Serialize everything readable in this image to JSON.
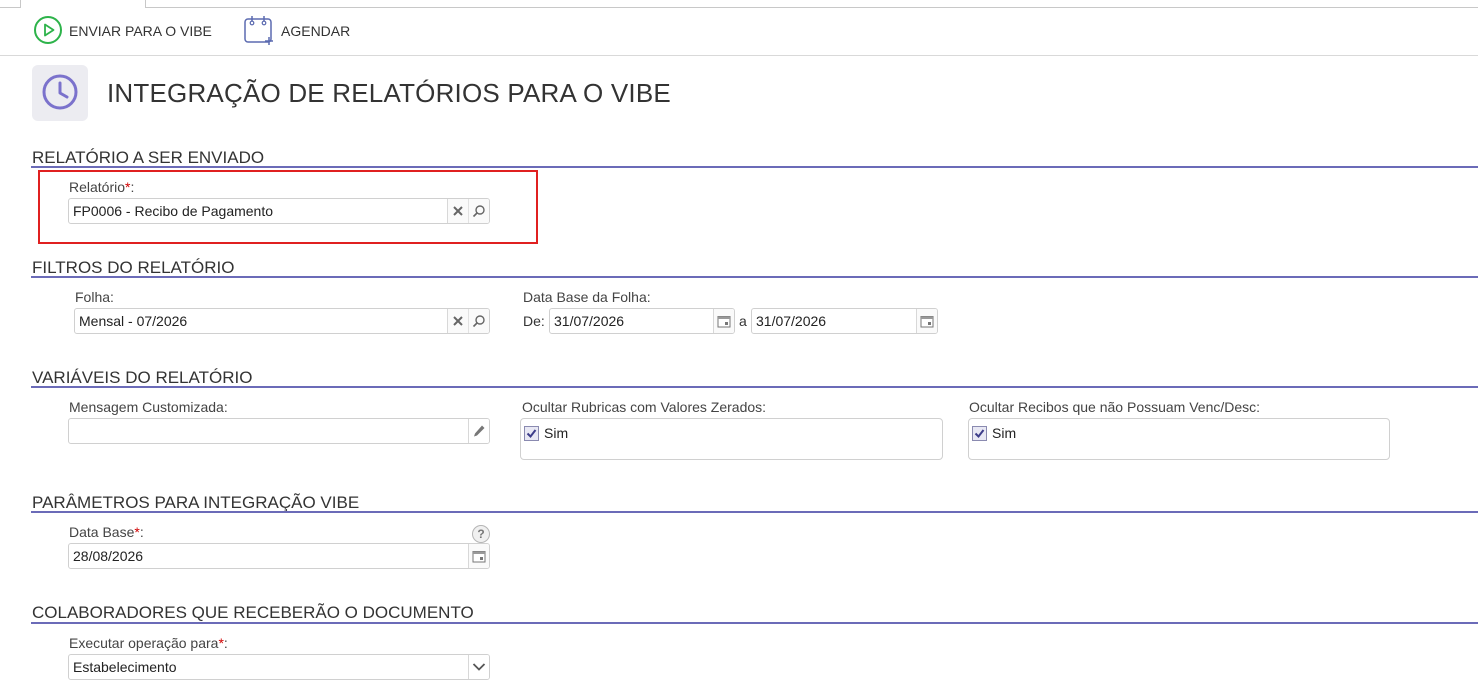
{
  "toolbar": {
    "send_label": "ENVIAR PARA O VIBE",
    "schedule_label": "AGENDAR"
  },
  "page": {
    "title": "INTEGRAÇÃO DE RELATÓRIOS PARA O VIBE"
  },
  "sections": {
    "report": {
      "title": "RELATÓRIO A SER ENVIADO",
      "report_label": "Relatório",
      "report_required": "*",
      "report_label_suffix": ":",
      "report_value": "FP0006 - Recibo de Pagamento"
    },
    "filters": {
      "title": "FILTROS DO RELATÓRIO",
      "folha_label": "Folha:",
      "folha_value": "Mensal - 07/2026",
      "data_base_label": "Data Base da Folha:",
      "from_label": "De:",
      "from_value": "31/07/2026",
      "to_label": "a",
      "to_value": "31/07/2026"
    },
    "variables": {
      "title": "VARIÁVEIS DO RELATÓRIO",
      "message_label": "Mensagem Customizada:",
      "message_value": "",
      "hide_zero_label": "Ocultar Rubricas com Valores Zerados:",
      "hide_zero_option": "Sim",
      "hide_zero_checked": true,
      "hide_receipts_label": "Ocultar Recibos que não Possuam Venc/Desc:",
      "hide_receipts_option": "Sim",
      "hide_receipts_checked": true
    },
    "params": {
      "title": "PARÂMETROS PARA INTEGRAÇÃO VIBE",
      "data_base_label": "Data Base",
      "data_base_required": "*",
      "data_base_suffix": ":",
      "data_base_value": "28/08/2026",
      "help": "?"
    },
    "collaborators": {
      "title": "COLABORADORES QUE RECEBERÃO O DOCUMENTO",
      "exec_label": "Executar operação para",
      "exec_required": "*",
      "exec_suffix": ":",
      "exec_value": "Estabelecimento"
    }
  },
  "colors": {
    "accent": "#6b6bb8",
    "send_icon": "#2db34a",
    "highlight": "#e02020",
    "required": "#d00000"
  },
  "icons": {
    "send": "play-circle-icon",
    "schedule": "calendar-add-icon",
    "page": "clock-icon",
    "clear": "close-icon",
    "search": "search-icon",
    "calendar": "calendar-icon",
    "edit": "pencil-icon",
    "dropdown": "chevron-down-icon"
  }
}
